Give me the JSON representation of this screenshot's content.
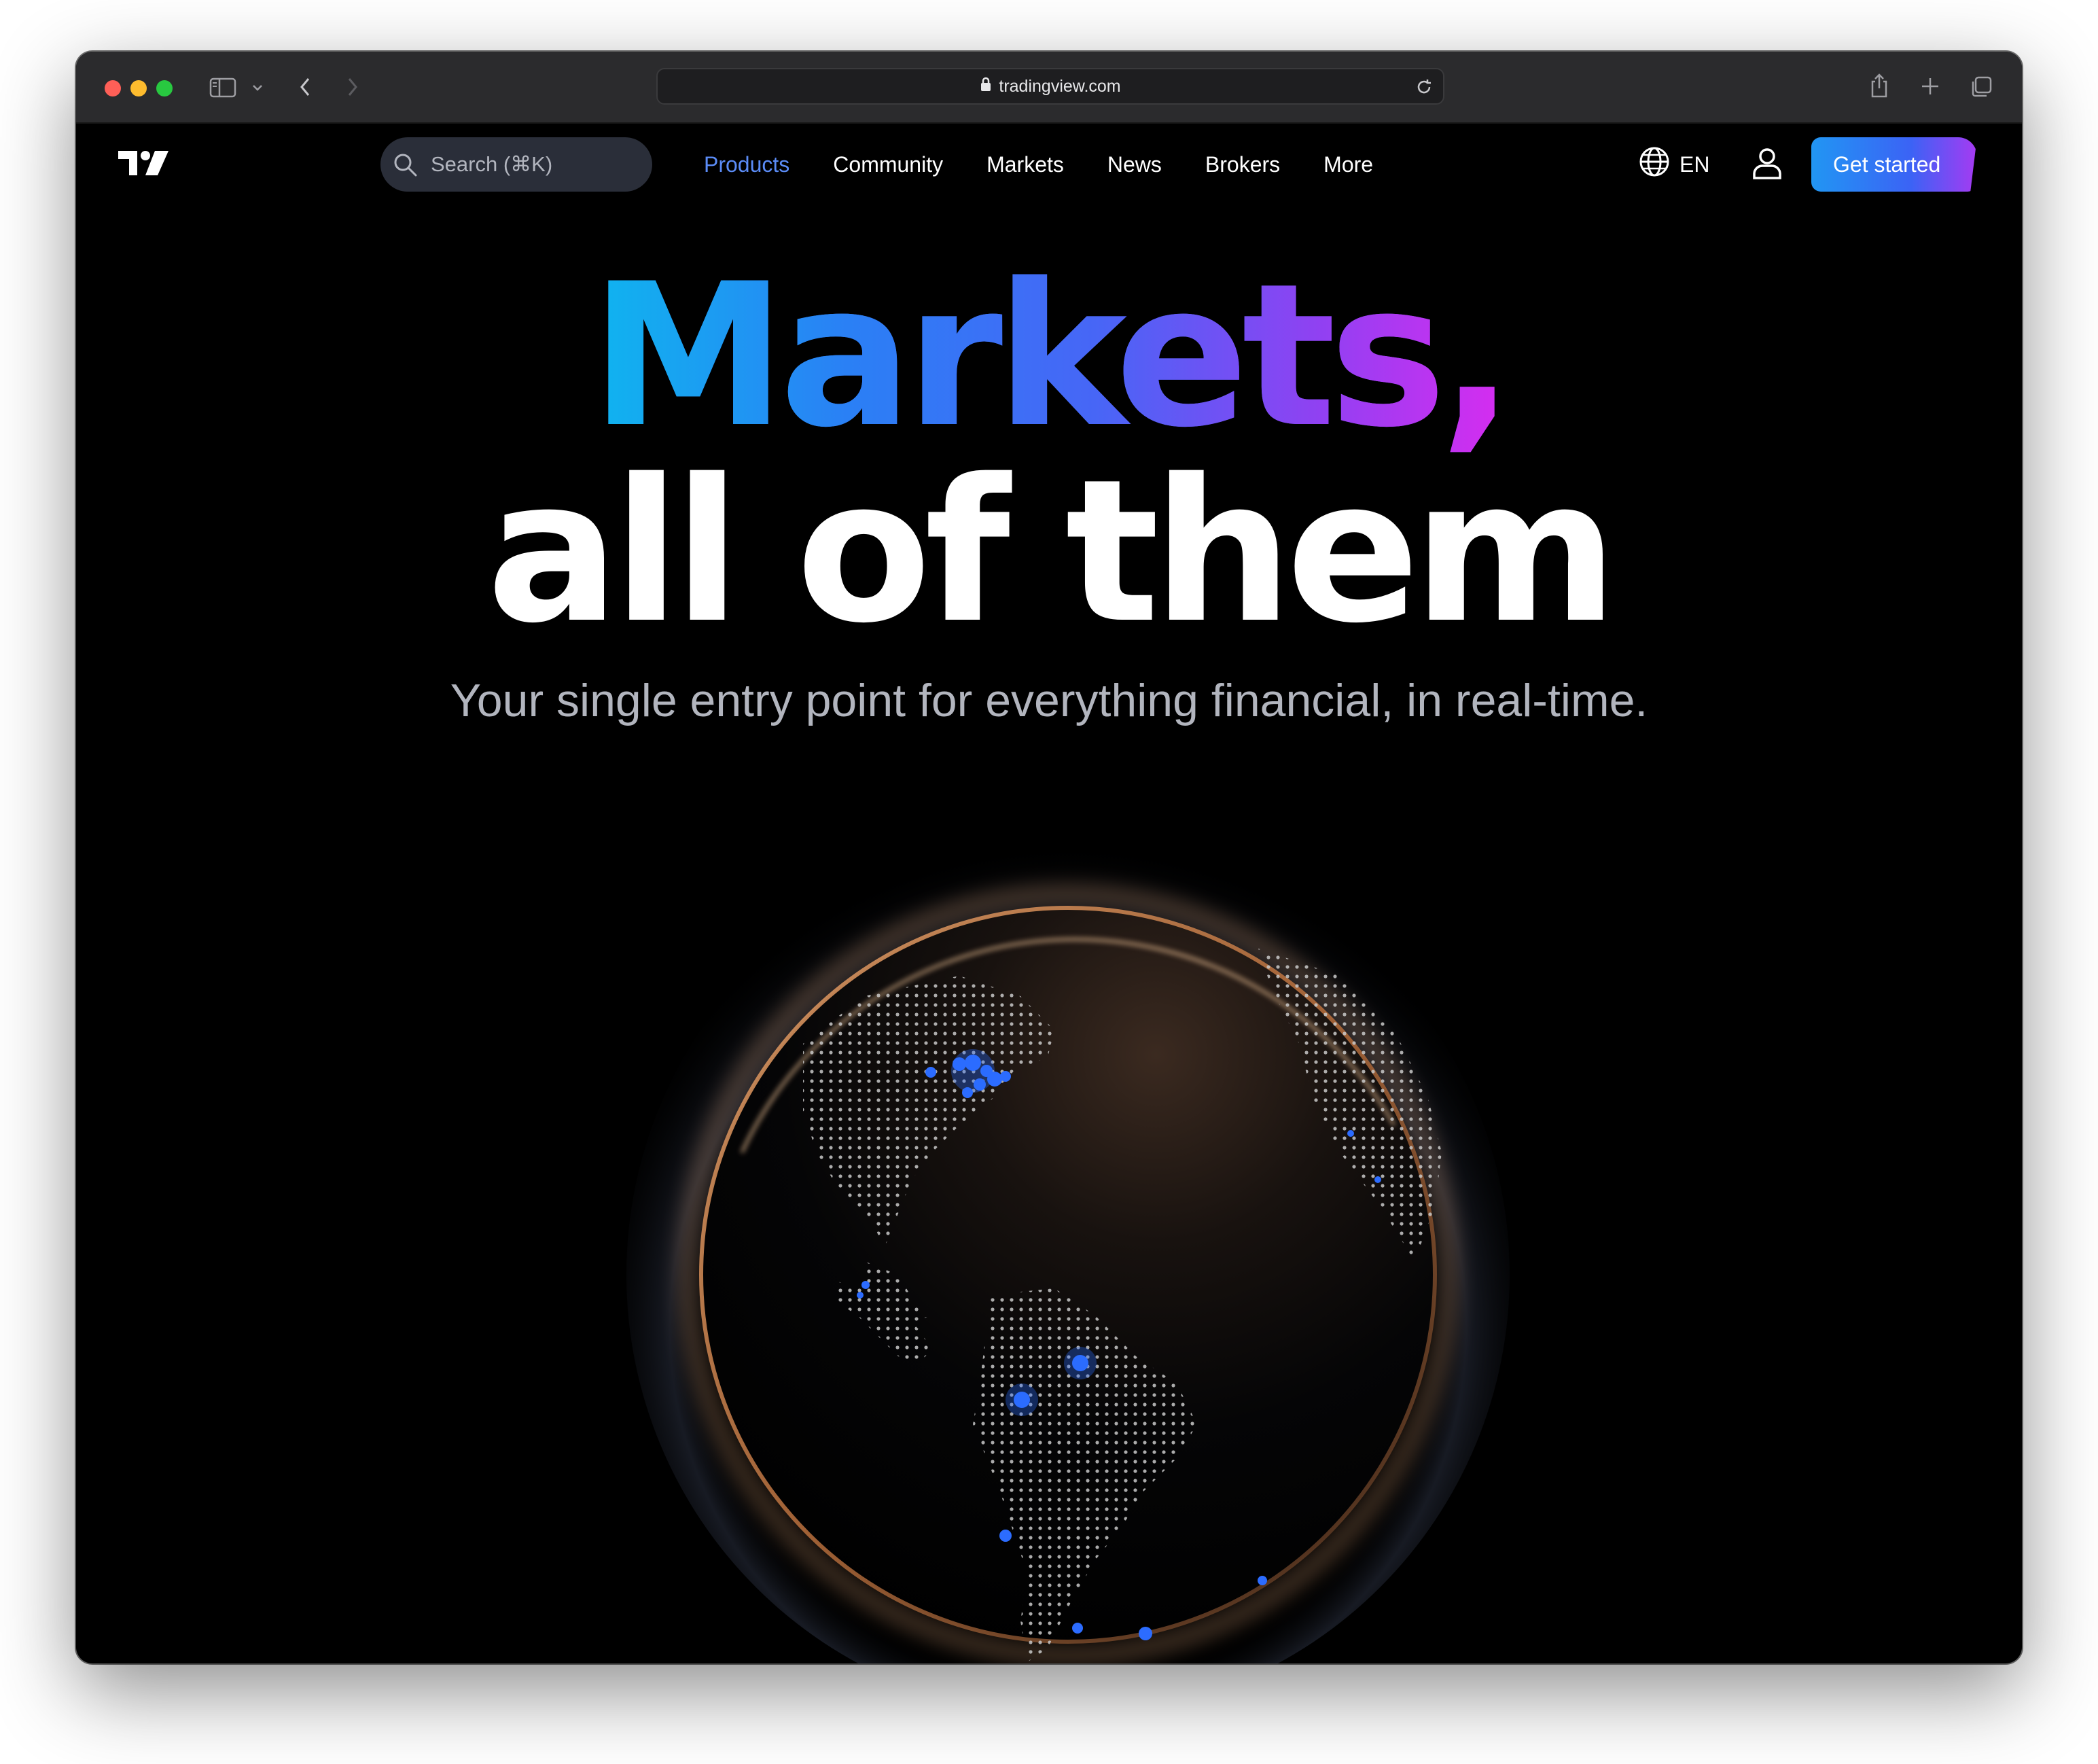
{
  "browser": {
    "url": "tradingview.com",
    "icons": [
      "sidebar-icon",
      "chevron-down-icon",
      "back-icon",
      "forward-icon",
      "lock-icon",
      "reload-icon",
      "share-icon",
      "plus-icon",
      "tabs-icon"
    ]
  },
  "nav": {
    "logo": "TradingView logo",
    "search_placeholder": "Search (⌘K)",
    "items": [
      {
        "label": "Products",
        "active": true
      },
      {
        "label": "Community",
        "active": false
      },
      {
        "label": "Markets",
        "active": false
      },
      {
        "label": "News",
        "active": false
      },
      {
        "label": "Brokers",
        "active": false
      },
      {
        "label": "More",
        "active": false
      }
    ],
    "language": "EN",
    "cta": "Get started"
  },
  "hero": {
    "title_line1": "Markets,",
    "title_line2": "all of them",
    "subtitle": "Your single entry point for everything financial, in real-time."
  },
  "colors": {
    "page_bg": "#000000",
    "accent_active": "#5b8cf7",
    "gradient_start": "#10b3f0",
    "gradient_end": "#d82cf0",
    "globe_rim": "#c07a45"
  }
}
